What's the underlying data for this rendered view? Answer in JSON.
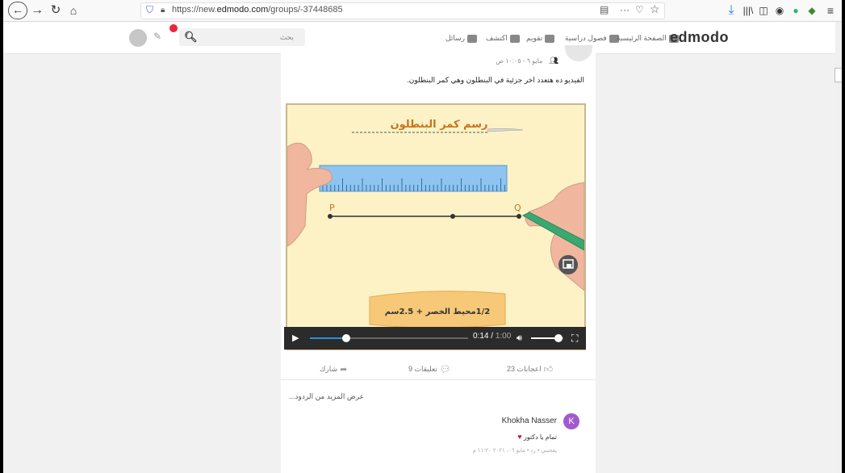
{
  "browser": {
    "url_prefix": "https://new.",
    "url_domain": "edmodo.com",
    "url_path": "/groups/-37448685",
    "icons": [
      "back-icon",
      "forward-icon",
      "reload-icon",
      "home-icon",
      "shield-icon",
      "lock-icon",
      "reader-icon",
      "more-icon",
      "pocket-icon",
      "bookmark-star-icon",
      "download-icon",
      "library-icon",
      "sidebar-icon",
      "account-icon",
      "extension-icon",
      "extension-icon-2",
      "menu-icon"
    ]
  },
  "header": {
    "logo": "edmodo",
    "nav": [
      {
        "label": "الصفحة الرئيسية",
        "icon": "home-icon"
      },
      {
        "label": "فصول دراسية",
        "icon": "classes-icon"
      },
      {
        "label": "تقويم",
        "icon": "calendar-icon"
      },
      {
        "label": "اكتشف",
        "icon": "discover-icon"
      },
      {
        "label": "رسائل",
        "icon": "messages-icon"
      }
    ],
    "search_placeholder": "بحث"
  },
  "post": {
    "meta": "مايو ٦ - ١٠:٠٥ ص",
    "text": "الفيديو ده هتعدد اخر جزئية في البنطلون وهي كمر البنطلون.",
    "video": {
      "title": "رسم كمر البنطلون",
      "point_p": "P",
      "point_q": "Q",
      "formula": "1/2محيط الخصر + 2.5سم",
      "time_current": "0:14",
      "time_total": "1:00",
      "progress": 0.23,
      "volume": 0.85
    },
    "actions": {
      "likes": "23 اعجابات",
      "comments": "9 تعليقات",
      "share": "شارك"
    },
    "show_more": "عرض المزيد من الردود..."
  },
  "comment": {
    "avatar_letter": "K",
    "author": "Khokha Nasser",
    "text": "تمام يا دكتور",
    "meta": "يعجبني • رد • مايو ٠٦، ٢٠٢١ ١١:٢٠ م"
  }
}
